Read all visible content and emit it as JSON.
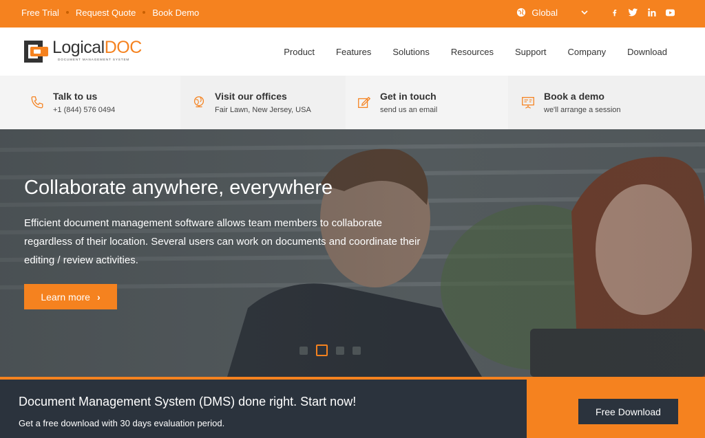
{
  "topbar": {
    "links": [
      "Free Trial",
      "Request Quote",
      "Book Demo"
    ],
    "region": "Global",
    "social": [
      "facebook-icon",
      "twitter-icon",
      "linkedin-icon",
      "youtube-icon"
    ]
  },
  "header": {
    "logo_word_1": "Logical",
    "logo_word_2": "DOC",
    "logo_tagline": "Document Management System",
    "nav": [
      "Product",
      "Features",
      "Solutions",
      "Resources",
      "Support",
      "Company",
      "Download"
    ]
  },
  "contacts": [
    {
      "icon": "phone-icon",
      "title": "Talk to us",
      "sub": "+1 (844) 576 0494"
    },
    {
      "icon": "globe-icon",
      "title": "Visit our offices",
      "sub": "Fair Lawn, New Jersey, USA"
    },
    {
      "icon": "edit-icon",
      "title": "Get in touch",
      "sub": "send us an email"
    },
    {
      "icon": "presentation-icon",
      "title": "Book a demo",
      "sub": "we'll arrange a session"
    }
  ],
  "hero": {
    "title": "Collaborate anywhere, everywhere",
    "text": "Efficient document management software allows team members to collaborate regardless of their location. Several users can work on documents and coordinate their editing / review activities.",
    "button": "Learn more",
    "slides": 4,
    "active_slide": 2
  },
  "cta": {
    "title": "Document Management System (DMS) done right. Start now!",
    "sub": "Get a free download with 30 days evaluation period.",
    "button": "Free Download"
  },
  "colors": {
    "accent": "#f5821f",
    "dark": "#2b333d"
  }
}
